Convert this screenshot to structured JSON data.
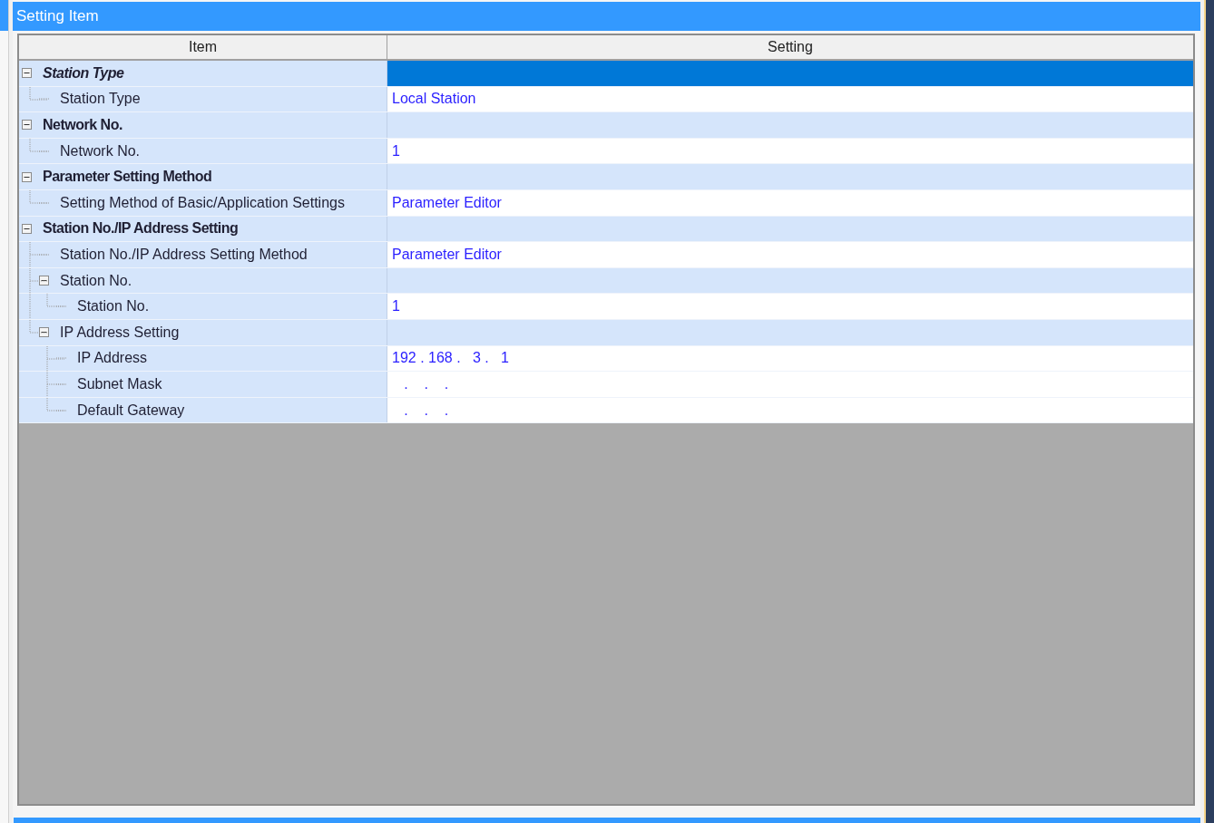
{
  "panel": {
    "title": "Setting Item"
  },
  "table": {
    "columns": [
      "Item",
      "Setting"
    ],
    "rows": [
      {
        "kind": "group",
        "label": "Station Type",
        "selected": true,
        "expanded": true,
        "children": [
          {
            "kind": "item",
            "label": "Station Type",
            "value": "Local Station",
            "selected": false
          }
        ]
      },
      {
        "kind": "group",
        "label": "Network No.",
        "selected": false,
        "expanded": true,
        "children": [
          {
            "kind": "item",
            "label": "Network No.",
            "value": "1",
            "selected": false
          }
        ]
      },
      {
        "kind": "group",
        "label": "Parameter Setting Method",
        "selected": false,
        "expanded": true,
        "children": [
          {
            "kind": "item",
            "label": "Setting Method of Basic/Application Settings",
            "value": "Parameter Editor",
            "selected": false
          }
        ]
      },
      {
        "kind": "group",
        "label": "Station No./IP Address Setting",
        "selected": false,
        "expanded": true,
        "children": [
          {
            "kind": "item",
            "label": "Station No./IP Address Setting Method",
            "value": "Parameter Editor",
            "selected": false
          },
          {
            "kind": "subgroup",
            "label": "Station No.",
            "selected": false,
            "expanded": true,
            "children": [
              {
                "kind": "item",
                "label": "Station No.",
                "value": "1",
                "selected": false
              }
            ]
          },
          {
            "kind": "subgroup",
            "label": "IP Address Setting",
            "selected": false,
            "expanded": true,
            "children": [
              {
                "kind": "item",
                "label": "IP Address",
                "value": "192 . 168 .   3 .   1",
                "selected": false
              },
              {
                "kind": "item",
                "label": "Subnet Mask",
                "value": "   .    .    .",
                "selected": false
              },
              {
                "kind": "item",
                "label": "Default Gateway",
                "value": "   .    .    .",
                "selected": false
              }
            ]
          }
        ]
      }
    ]
  }
}
